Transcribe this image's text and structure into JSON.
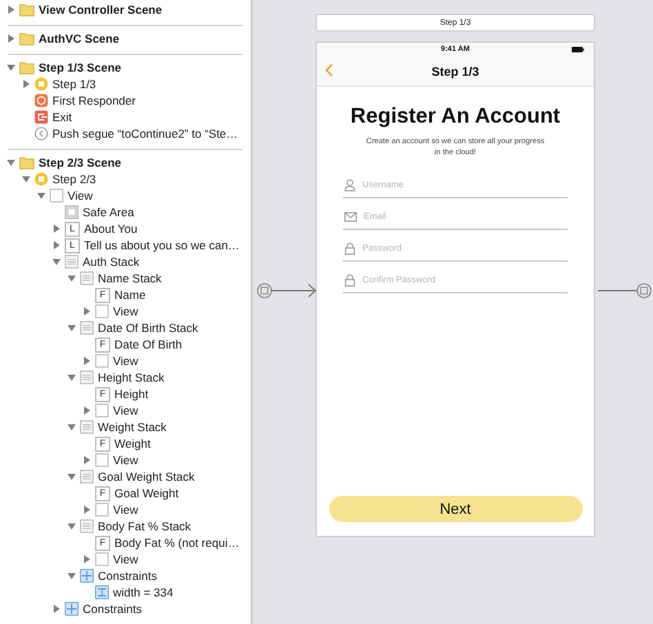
{
  "outline": {
    "items": [
      {
        "label": "View Controller Scene",
        "kind": "folder",
        "expanded": false
      },
      {
        "label": "AuthVC Scene",
        "kind": "folder",
        "expanded": false
      },
      {
        "label": "Step 1/3 Scene",
        "kind": "folder",
        "expanded": true,
        "children": [
          {
            "label": "Step 1/3",
            "kind": "controller",
            "expanded": false
          },
          {
            "label": "First Responder",
            "kind": "responder"
          },
          {
            "label": "Exit",
            "kind": "exit"
          },
          {
            "label": "Push segue “toContinue2” to “Ste…",
            "kind": "segue"
          }
        ]
      },
      {
        "label": "Step 2/3 Scene",
        "kind": "folder",
        "expanded": true,
        "children": [
          {
            "label": "Step 2/3",
            "kind": "controller",
            "expanded": true,
            "children": [
              {
                "label": "View",
                "kind": "view",
                "expanded": true,
                "children": [
                  {
                    "label": "Safe Area",
                    "kind": "safe-area"
                  },
                  {
                    "label": "About You",
                    "kind": "label",
                    "glyph": "L",
                    "expanded": false
                  },
                  {
                    "label": "Tell us about you so we can…",
                    "kind": "label",
                    "glyph": "L",
                    "expanded": false
                  },
                  {
                    "label": "Auth Stack",
                    "kind": "stack",
                    "expanded": true,
                    "children": [
                      {
                        "label": "Name Stack",
                        "kind": "stack",
                        "expanded": true,
                        "children": [
                          {
                            "label": "Name",
                            "kind": "field",
                            "glyph": "F"
                          },
                          {
                            "label": "View",
                            "kind": "view",
                            "expanded": false
                          }
                        ]
                      },
                      {
                        "label": "Date Of Birth Stack",
                        "kind": "stack",
                        "expanded": true,
                        "children": [
                          {
                            "label": "Date Of Birth",
                            "kind": "field",
                            "glyph": "F"
                          },
                          {
                            "label": "View",
                            "kind": "view",
                            "expanded": false
                          }
                        ]
                      },
                      {
                        "label": "Height Stack",
                        "kind": "stack",
                        "expanded": true,
                        "children": [
                          {
                            "label": "Height",
                            "kind": "field",
                            "glyph": "F"
                          },
                          {
                            "label": "View",
                            "kind": "view",
                            "expanded": false
                          }
                        ]
                      },
                      {
                        "label": "Weight Stack",
                        "kind": "stack",
                        "expanded": true,
                        "children": [
                          {
                            "label": "Weight",
                            "kind": "field",
                            "glyph": "F"
                          },
                          {
                            "label": "View",
                            "kind": "view",
                            "expanded": false
                          }
                        ]
                      },
                      {
                        "label": "Goal Weight Stack",
                        "kind": "stack",
                        "expanded": true,
                        "children": [
                          {
                            "label": "Goal Weight",
                            "kind": "field",
                            "glyph": "F"
                          },
                          {
                            "label": "View",
                            "kind": "view",
                            "expanded": false
                          }
                        ]
                      },
                      {
                        "label": "Body Fat % Stack",
                        "kind": "stack",
                        "expanded": true,
                        "children": [
                          {
                            "label": "Body Fat % (not requi…",
                            "kind": "field",
                            "glyph": "F"
                          },
                          {
                            "label": "View",
                            "kind": "view",
                            "expanded": false
                          }
                        ]
                      },
                      {
                        "label": "Constraints",
                        "kind": "constraints",
                        "expanded": true,
                        "children": [
                          {
                            "label": "width = 334",
                            "kind": "constraint"
                          }
                        ]
                      }
                    ]
                  },
                  {
                    "label": "Constraints",
                    "kind": "constraints",
                    "expanded": false
                  }
                ]
              }
            ]
          }
        ]
      }
    ]
  },
  "canvas": {
    "scene_title": "Step 1/3",
    "phone": {
      "status_time": "9:41 AM",
      "nav_title": "Step 1/3",
      "heading": "Register An Account",
      "subtitle": "Create an account so we can store all your progress in the cloud!",
      "fields": [
        {
          "kind": "person",
          "placeholder": "Username"
        },
        {
          "kind": "mail",
          "placeholder": "Email"
        },
        {
          "kind": "lock",
          "placeholder": "Password"
        },
        {
          "kind": "lock",
          "placeholder": "Confirm Password"
        }
      ],
      "button": "Next"
    }
  }
}
